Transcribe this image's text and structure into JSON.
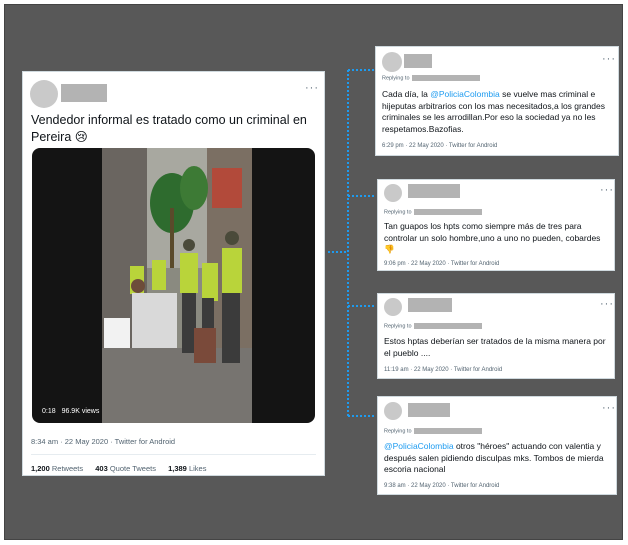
{
  "main_tweet": {
    "menu": "···",
    "text": "Vendedor informal es tratado como un criminal en Pereira 😢",
    "video": {
      "time": "0:18",
      "views": "96.9K views"
    },
    "meta": "8:34 am · 22 May 2020 · Twitter for Android",
    "stats": [
      {
        "count": "1,200",
        "label": "Retweets"
      },
      {
        "count": "403",
        "label": "Quote Tweets"
      },
      {
        "count": "1,389",
        "label": "Likes"
      }
    ]
  },
  "replies": [
    {
      "replying_to": "Replying to",
      "menu": "···",
      "text_before": "Cada  día, la ",
      "mention": "@PoliciaColombia",
      "text_after": "  se vuelve mas criminal e hijeputas arbitrarios con los mas necesitados,a los grandes criminales se les arrodillan.Por eso la sociedad ya no les respetamos.Bazofias.",
      "meta": "6:29 pm · 22 May 2020 · Twitter for Android"
    },
    {
      "replying_to": "Replying to",
      "menu": "···",
      "text_before": "Tan guapos los hpts como siempre más de tres para controlar un solo hombre,uno a uno no pueden, cobardes 👎",
      "mention": "",
      "text_after": "",
      "meta": "9:06 pm · 22 May 2020 · Twitter for Android"
    },
    {
      "replying_to": "Replying to",
      "menu": "···",
      "text_before": "Estos hptas deberían ser tratados de la misma manera por el pueblo ....",
      "mention": "",
      "text_after": "",
      "meta": "11:19 am · 22 May 2020 · Twitter for Android"
    },
    {
      "replying_to": "Replying to",
      "menu": "···",
      "text_before": "",
      "mention": "@PoliciaColombia",
      "text_after": " otros \"héroes\" actuando con valentia y después salen pidiendo disculpas mks. Tombos de mierda escoria nacional",
      "meta": "9:38 am · 22 May 2020 · Twitter for Android"
    }
  ],
  "colors": {
    "mention": "#1d9bf0",
    "connector": "#1d9bf0",
    "panel": "#585858"
  }
}
